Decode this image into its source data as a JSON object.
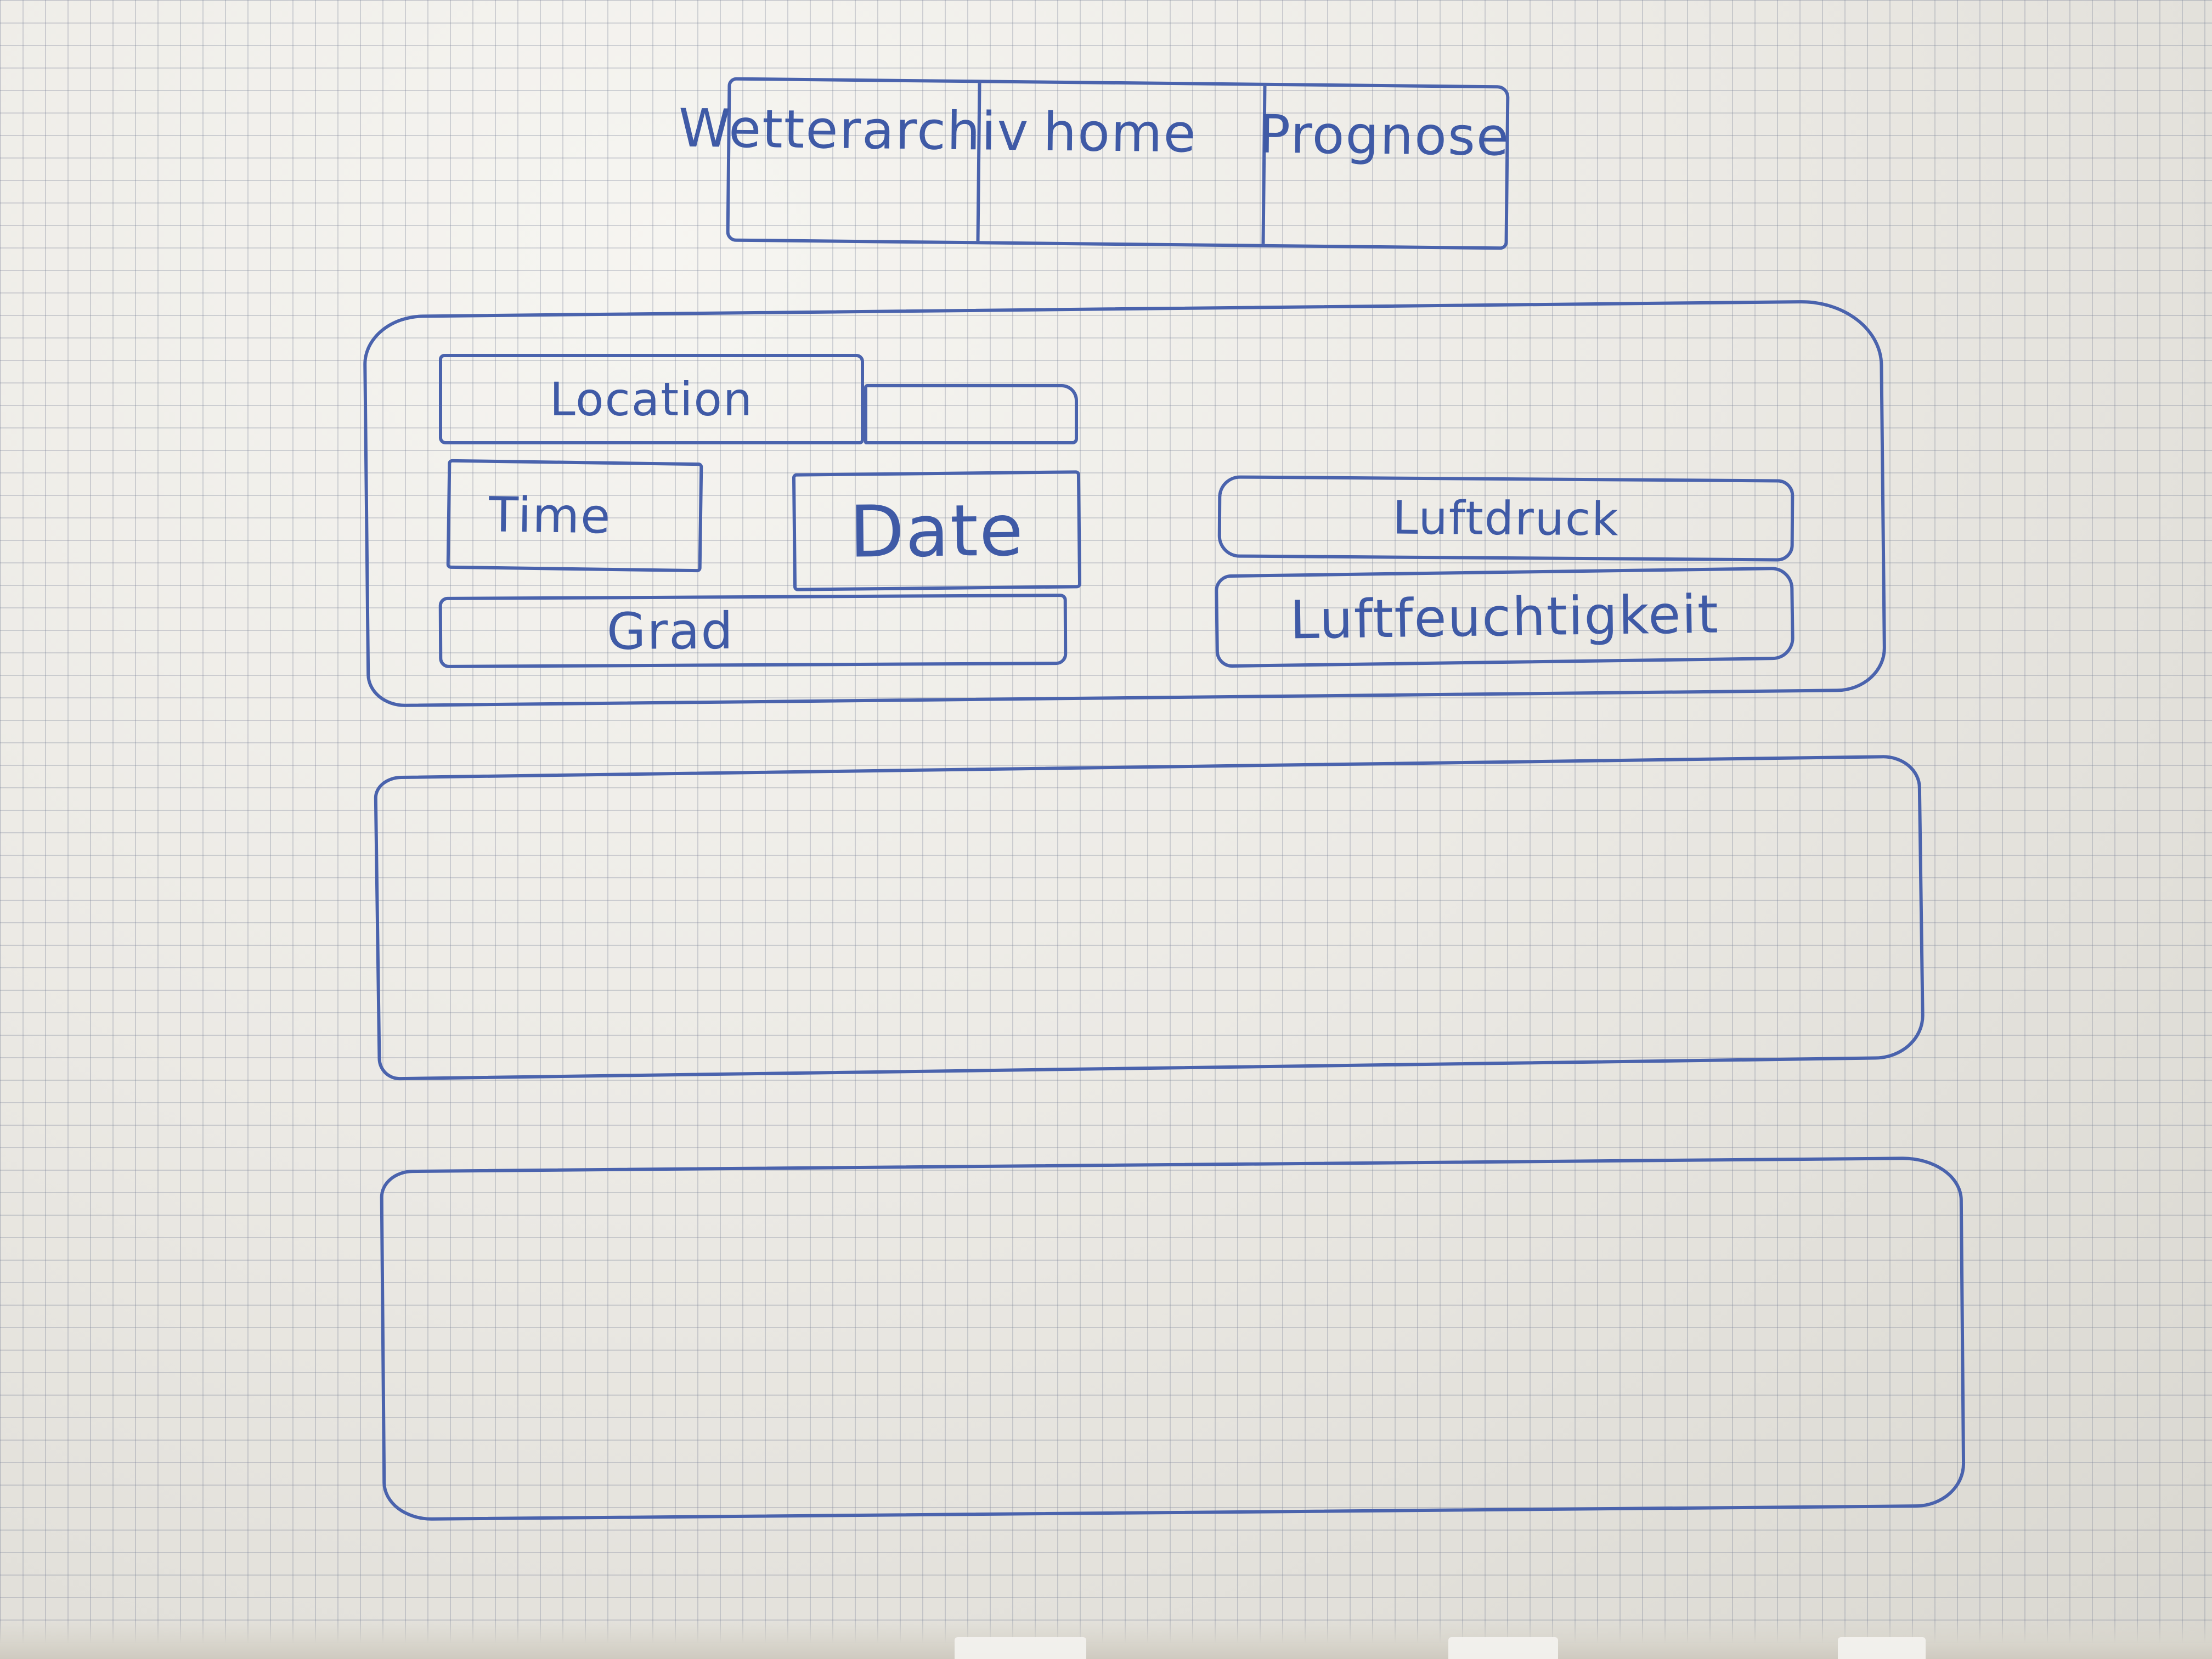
{
  "nav": {
    "items": [
      {
        "label": "Wetterarchiv"
      },
      {
        "label": "home"
      },
      {
        "label": "Prognose"
      }
    ]
  },
  "panel": {
    "location_label": "Location",
    "time_label": "Time",
    "date_label": "Date",
    "grad_label": "Grad",
    "luftdruck_label": "Luftdruck",
    "luftfeuchtigkeit_label": "Luftfeuchtigkeit"
  },
  "colors": {
    "ink": "#3f5aa6",
    "paper": "#e9e8e3",
    "grid": "#7880a0"
  }
}
